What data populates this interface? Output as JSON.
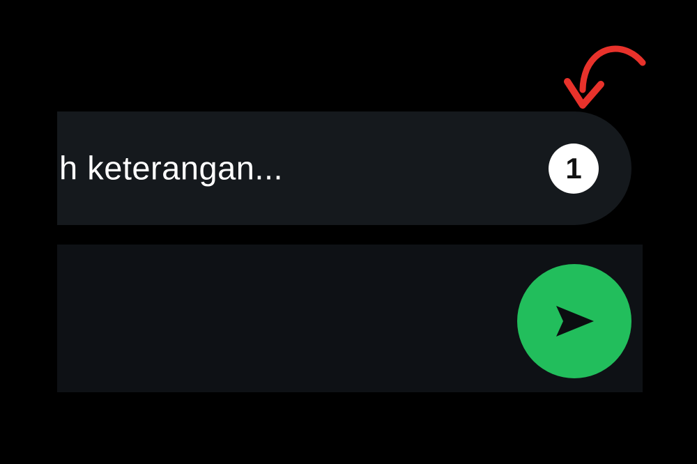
{
  "caption": {
    "text": "h keterangan..."
  },
  "view_once": {
    "label": "1"
  },
  "send": {
    "icon": "send-icon"
  },
  "annotation": {
    "icon": "curved-arrow-icon",
    "color": "#e8322b"
  },
  "colors": {
    "background": "#000000",
    "caption_bar": "#15191d",
    "bottom_bar": "#0e1115",
    "send_button": "#22be5c",
    "badge": "#ffffff"
  }
}
